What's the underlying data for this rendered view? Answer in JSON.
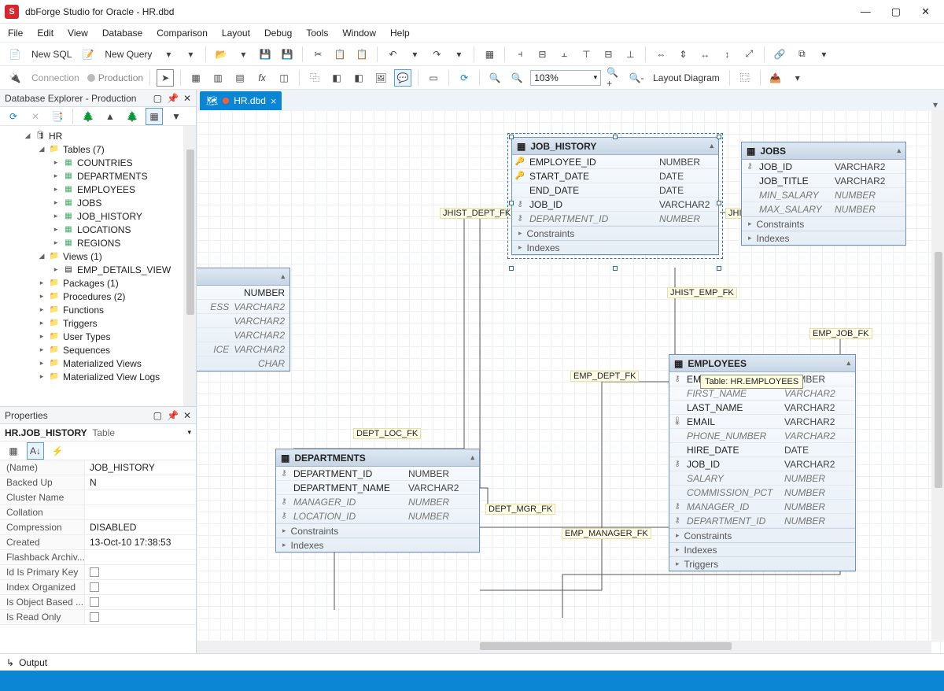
{
  "app": {
    "title": "dbForge Studio for Oracle - HR.dbd"
  },
  "menu": [
    "File",
    "Edit",
    "View",
    "Database",
    "Comparison",
    "Layout",
    "Debug",
    "Tools",
    "Window",
    "Help"
  ],
  "toolbar1": {
    "newsql": "New SQL",
    "newquery": "New Query",
    "connection_label": "Connection",
    "connection_value": "Production"
  },
  "toolbar2": {
    "zoom": "103%",
    "layout_diagram": "Layout Diagram"
  },
  "explorer": {
    "title": "Database Explorer - Production",
    "db": "HR",
    "tables_label": "Tables (7)",
    "tables": [
      "COUNTRIES",
      "DEPARTMENTS",
      "EMPLOYEES",
      "JOBS",
      "JOB_HISTORY",
      "LOCATIONS",
      "REGIONS"
    ],
    "views_label": "Views (1)",
    "view1": "EMP_DETAILS_VIEW",
    "folders": [
      "Packages (1)",
      "Procedures (2)",
      "Functions",
      "Triggers",
      "User Types",
      "Sequences",
      "Materialized Views",
      "Materialized View Logs"
    ]
  },
  "properties": {
    "title": "Properties",
    "object_name": "HR.JOB_HISTORY",
    "object_type": "Table",
    "rows": [
      {
        "k": "(Name)",
        "v": "JOB_HISTORY"
      },
      {
        "k": "Backed Up",
        "v": "N"
      },
      {
        "k": "Cluster Name",
        "v": ""
      },
      {
        "k": "Collation",
        "v": ""
      },
      {
        "k": "Compression",
        "v": "DISABLED"
      },
      {
        "k": "Created",
        "v": "13-Oct-10 17:38:53"
      },
      {
        "k": "Flashback Archiv...",
        "v": ""
      },
      {
        "k": "Id Is Primary Key",
        "v": "[ ]"
      },
      {
        "k": "Index Organized",
        "v": "[ ]"
      },
      {
        "k": "Is Object Based ...",
        "v": "[ ]"
      },
      {
        "k": "Is Read Only",
        "v": "[ ]"
      }
    ]
  },
  "tab": "HR.dbd",
  "entities": {
    "job_history": {
      "name": "JOB_HISTORY",
      "cols": [
        {
          "i": "pk",
          "n": "EMPLOYEE_ID",
          "t": "NUMBER"
        },
        {
          "i": "pk",
          "n": "START_DATE",
          "t": "DATE"
        },
        {
          "i": "",
          "n": "END_DATE",
          "t": "DATE"
        },
        {
          "i": "key",
          "n": "JOB_ID",
          "t": "VARCHAR2"
        },
        {
          "i": "key",
          "n": "DEPARTMENT_ID",
          "t": "NUMBER",
          "fk": true
        }
      ],
      "sections": [
        "Constraints",
        "Indexes"
      ]
    },
    "jobs": {
      "name": "JOBS",
      "cols": [
        {
          "i": "key",
          "n": "JOB_ID",
          "t": "VARCHAR2"
        },
        {
          "i": "",
          "n": "JOB_TITLE",
          "t": "VARCHAR2"
        },
        {
          "i": "",
          "n": "MIN_SALARY",
          "t": "NUMBER",
          "fk": true
        },
        {
          "i": "",
          "n": "MAX_SALARY",
          "t": "NUMBER",
          "fk": true
        }
      ],
      "sections": [
        "Constraints",
        "Indexes"
      ]
    },
    "departments": {
      "name": "DEPARTMENTS",
      "cols": [
        {
          "i": "key",
          "n": "DEPARTMENT_ID",
          "t": "NUMBER"
        },
        {
          "i": "",
          "n": "DEPARTMENT_NAME",
          "t": "VARCHAR2"
        },
        {
          "i": "key",
          "n": "MANAGER_ID",
          "t": "NUMBER",
          "fk": true
        },
        {
          "i": "key",
          "n": "LOCATION_ID",
          "t": "NUMBER",
          "fk": true
        }
      ],
      "sections": [
        "Constraints",
        "Indexes"
      ]
    },
    "employees": {
      "name": "EMPLOYEES",
      "cols": [
        {
          "i": "key",
          "n": "EMPLOYEE_ID",
          "t": "NUMBER"
        },
        {
          "i": "",
          "n": "FIRST_NAME",
          "t": "VARCHAR2",
          "fk": true
        },
        {
          "i": "",
          "n": "LAST_NAME",
          "t": "VARCHAR2"
        },
        {
          "i": "idx",
          "n": "EMAIL",
          "t": "VARCHAR2"
        },
        {
          "i": "",
          "n": "PHONE_NUMBER",
          "t": "VARCHAR2",
          "fk": true
        },
        {
          "i": "",
          "n": "HIRE_DATE",
          "t": "DATE"
        },
        {
          "i": "key",
          "n": "JOB_ID",
          "t": "VARCHAR2"
        },
        {
          "i": "",
          "n": "SALARY",
          "t": "NUMBER",
          "fk": true
        },
        {
          "i": "",
          "n": "COMMISSION_PCT",
          "t": "NUMBER",
          "fk": true
        },
        {
          "i": "key",
          "n": "MANAGER_ID",
          "t": "NUMBER",
          "fk": true
        },
        {
          "i": "key",
          "n": "DEPARTMENT_ID",
          "t": "NUMBER",
          "fk": true
        }
      ],
      "sections": [
        "Constraints",
        "Indexes",
        "Triggers"
      ]
    },
    "truncated": {
      "cols": [
        {
          "n": "NUMBER"
        },
        {
          "n": "VARCHAR2",
          "x": "ESS"
        },
        {
          "n": "VARCHAR2",
          "x": ""
        },
        {
          "n": "VARCHAR2",
          "x": ""
        },
        {
          "n": "VARCHAR2",
          "x": "ICE"
        },
        {
          "n": "CHAR",
          "x": ""
        }
      ]
    }
  },
  "fk_labels": {
    "jhist_dept": "JHIST_DEPT_FK",
    "jhist_job": "JHIST_JOB_FK",
    "jhist_emp": "JHIST_EMP_FK",
    "emp_job": "EMP_JOB_FK",
    "emp_dept": "EMP_DEPT_FK",
    "emp_manager": "EMP_MANAGER_FK",
    "dept_mgr": "DEPT_MGR_FK",
    "dept_loc": "DEPT_LOC_FK"
  },
  "tooltip": "Table: HR.EMPLOYEES",
  "output": "Output"
}
